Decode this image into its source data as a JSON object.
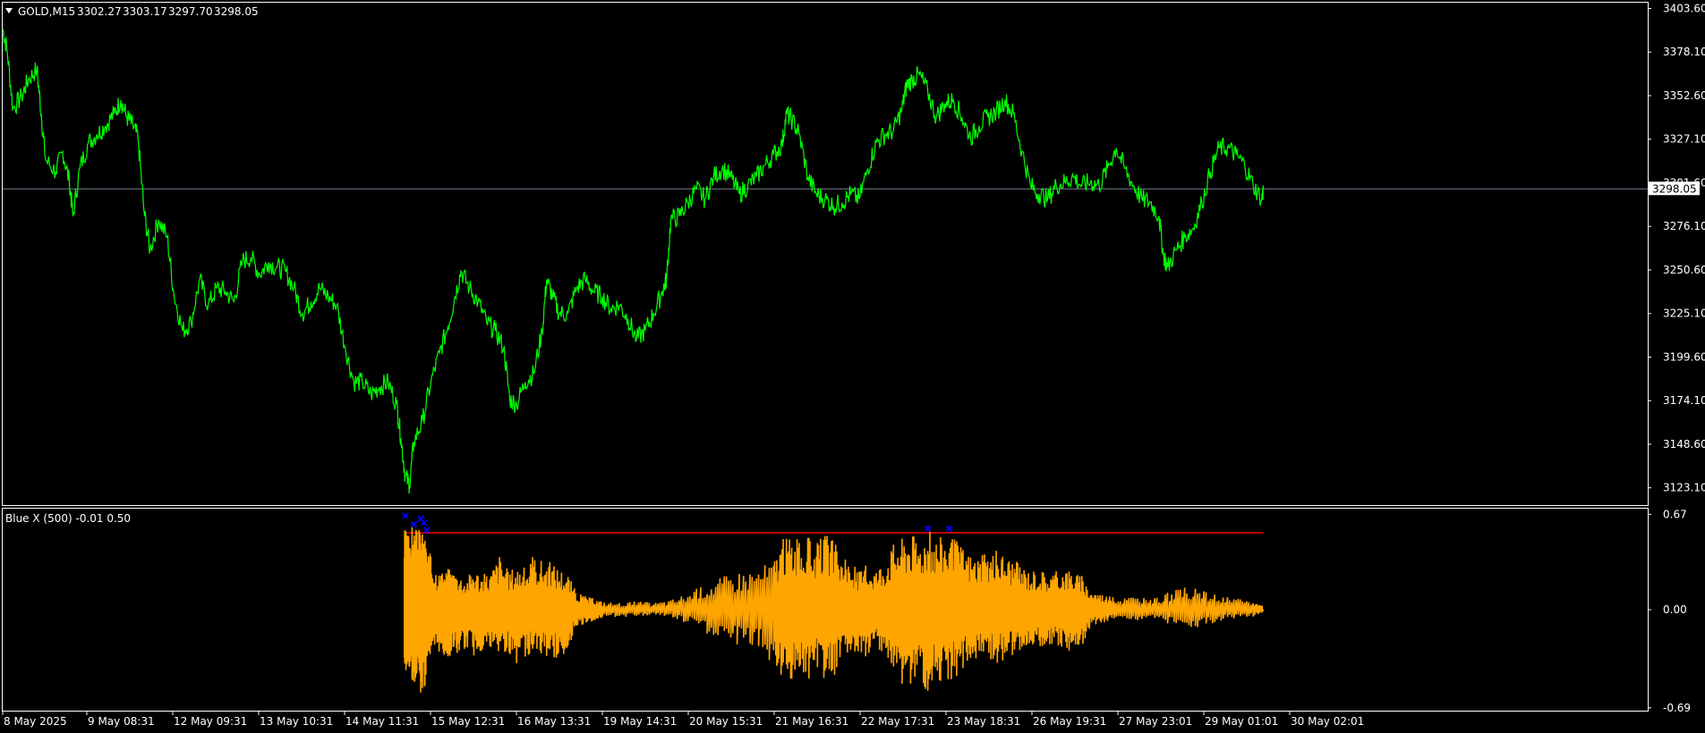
{
  "main_header": {
    "dropdown_icon": "triangle-down-icon",
    "symbol": "GOLD,M15",
    "open": "3302.27",
    "high": "3303.17",
    "low": "3297.70",
    "close": "3298.05"
  },
  "indicator_header": {
    "label": "Blue X (500) -0.01 0.50"
  },
  "colors": {
    "background": "#000000",
    "price_line": "#00ff00",
    "indicator": "#ffa500",
    "threshold": "#ff0000",
    "signal": "#0000ff",
    "frame": "#ffffff",
    "bid_line": "#708090"
  },
  "chart_data": [
    {
      "type": "line",
      "name_in_chart": "GOLD,M15",
      "y_ticks": [
        "3403.60",
        "3378.10",
        "3352.60",
        "3327.10",
        "3301.60",
        "3276.10",
        "3250.60",
        "3225.10",
        "3199.60",
        "3174.10",
        "3148.60",
        "3123.10"
      ],
      "ylim": [
        3113.0,
        3407.0
      ],
      "current_price_label": "3298.05",
      "current_price": 3298.05,
      "x_ticks": [
        "8 May 2025",
        "9 May 08:31",
        "12 May 09:31",
        "13 May 10:31",
        "14 May 11:31",
        "15 May 12:31",
        "16 May 13:31",
        "19 May 14:31",
        "20 May 15:31",
        "21 May 16:31",
        "22 May 17:31",
        "23 May 18:31",
        "26 May 19:31",
        "27 May 23:01",
        "29 May 01:01",
        "30 May 02:01"
      ],
      "x_range": [
        0,
        15.35
      ],
      "points": [
        [
          0,
          3392
        ],
        [
          0.05,
          3380
        ],
        [
          0.12,
          3345
        ],
        [
          0.22,
          3352
        ],
        [
          0.3,
          3362
        ],
        [
          0.4,
          3368
        ],
        [
          0.45,
          3342
        ],
        [
          0.5,
          3315
        ],
        [
          0.62,
          3308
        ],
        [
          0.7,
          3320
        ],
        [
          0.78,
          3302
        ],
        [
          0.82,
          3282
        ],
        [
          0.9,
          3310
        ],
        [
          1.0,
          3325
        ],
        [
          1.1,
          3330
        ],
        [
          1.2,
          3335
        ],
        [
          1.3,
          3342
        ],
        [
          1.38,
          3350
        ],
        [
          1.45,
          3340
        ],
        [
          1.52,
          3335
        ],
        [
          1.58,
          3328
        ],
        [
          1.65,
          3285
        ],
        [
          1.72,
          3262
        ],
        [
          1.82,
          3280
        ],
        [
          1.92,
          3270
        ],
        [
          2.0,
          3236
        ],
        [
          2.1,
          3215
        ],
        [
          2.2,
          3220
        ],
        [
          2.3,
          3245
        ],
        [
          2.4,
          3230
        ],
        [
          2.5,
          3240
        ],
        [
          2.6,
          3238
        ],
        [
          2.7,
          3232
        ],
        [
          2.8,
          3256
        ],
        [
          2.9,
          3258
        ],
        [
          3.0,
          3248
        ],
        [
          3.1,
          3255
        ],
        [
          3.2,
          3252
        ],
        [
          3.3,
          3250
        ],
        [
          3.4,
          3240
        ],
        [
          3.5,
          3225
        ],
        [
          3.6,
          3232
        ],
        [
          3.7,
          3240
        ],
        [
          3.8,
          3235
        ],
        [
          3.9,
          3230
        ],
        [
          4.0,
          3205
        ],
        [
          4.1,
          3185
        ],
        [
          4.2,
          3185
        ],
        [
          4.3,
          3178
        ],
        [
          4.4,
          3182
        ],
        [
          4.5,
          3185
        ],
        [
          4.6,
          3172
        ],
        [
          4.65,
          3152
        ],
        [
          4.7,
          3130
        ],
        [
          4.75,
          3125
        ],
        [
          4.8,
          3150
        ],
        [
          4.9,
          3162
        ],
        [
          5.0,
          3185
        ],
        [
          5.1,
          3202
        ],
        [
          5.2,
          3218
        ],
        [
          5.28,
          3235
        ],
        [
          5.35,
          3250
        ],
        [
          5.45,
          3240
        ],
        [
          5.55,
          3232
        ],
        [
          5.65,
          3220
        ],
        [
          5.75,
          3215
        ],
        [
          5.85,
          3205
        ],
        [
          5.92,
          3175
        ],
        [
          6.0,
          3172
        ],
        [
          6.1,
          3185
        ],
        [
          6.2,
          3190
        ],
        [
          6.3,
          3215
        ],
        [
          6.35,
          3245
        ],
        [
          6.42,
          3235
        ],
        [
          6.5,
          3225
        ],
        [
          6.6,
          3225
        ],
        [
          6.7,
          3240
        ],
        [
          6.8,
          3245
        ],
        [
          6.9,
          3238
        ],
        [
          7.0,
          3235
        ],
        [
          7.1,
          3228
        ],
        [
          7.2,
          3230
        ],
        [
          7.3,
          3222
        ],
        [
          7.4,
          3210
        ],
        [
          7.5,
          3215
        ],
        [
          7.6,
          3225
        ],
        [
          7.7,
          3238
        ],
        [
          7.75,
          3245
        ],
        [
          7.8,
          3280
        ],
        [
          7.9,
          3282
        ],
        [
          8.0,
          3290
        ],
        [
          8.1,
          3298
        ],
        [
          8.2,
          3292
        ],
        [
          8.3,
          3305
        ],
        [
          8.4,
          3310
        ],
        [
          8.5,
          3305
        ],
        [
          8.6,
          3295
        ],
        [
          8.7,
          3300
        ],
        [
          8.8,
          3305
        ],
        [
          8.9,
          3312
        ],
        [
          9.0,
          3318
        ],
        [
          9.1,
          3324
        ],
        [
          9.15,
          3342
        ],
        [
          9.22,
          3338
        ],
        [
          9.3,
          3330
        ],
        [
          9.4,
          3305
        ],
        [
          9.5,
          3295
        ],
        [
          9.6,
          3292
        ],
        [
          9.7,
          3288
        ],
        [
          9.8,
          3290
        ],
        [
          9.9,
          3295
        ],
        [
          10.0,
          3292
        ],
        [
          10.1,
          3310
        ],
        [
          10.2,
          3325
        ],
        [
          10.3,
          3330
        ],
        [
          10.4,
          3332
        ],
        [
          10.5,
          3345
        ],
        [
          10.55,
          3358
        ],
        [
          10.62,
          3362
        ],
        [
          10.7,
          3365
        ],
        [
          10.8,
          3355
        ],
        [
          10.9,
          3340
        ],
        [
          11.0,
          3348
        ],
        [
          11.1,
          3350
        ],
        [
          11.2,
          3340
        ],
        [
          11.3,
          3328
        ],
        [
          11.4,
          3335
        ],
        [
          11.5,
          3340
        ],
        [
          11.6,
          3343
        ],
        [
          11.7,
          3350
        ],
        [
          11.8,
          3342
        ],
        [
          11.9,
          3320
        ],
        [
          12.0,
          3300
        ],
        [
          12.1,
          3295
        ],
        [
          12.2,
          3292
        ],
        [
          12.3,
          3300
        ],
        [
          12.4,
          3302
        ],
        [
          12.5,
          3305
        ],
        [
          12.6,
          3300
        ],
        [
          12.7,
          3302
        ],
        [
          12.8,
          3300
        ],
        [
          12.9,
          3310
        ],
        [
          13.0,
          3322
        ],
        [
          13.1,
          3310
        ],
        [
          13.2,
          3300
        ],
        [
          13.3,
          3292
        ],
        [
          13.4,
          3290
        ],
        [
          13.5,
          3282
        ],
        [
          13.55,
          3260
        ],
        [
          13.6,
          3252
        ],
        [
          13.7,
          3262
        ],
        [
          13.8,
          3270
        ],
        [
          13.9,
          3275
        ],
        [
          14.0,
          3290
        ],
        [
          14.1,
          3308
        ],
        [
          14.2,
          3322
        ],
        [
          14.3,
          3322
        ],
        [
          14.4,
          3318
        ],
        [
          14.5,
          3312
        ],
        [
          14.6,
          3300
        ],
        [
          14.7,
          3292
        ],
        [
          14.72,
          3298
        ]
      ]
    },
    {
      "type": "bar",
      "name_in_chart": "Blue X (500)",
      "y_ticks": [
        "0.67",
        "0.00",
        "-0.69"
      ],
      "ylim": [
        -0.71,
        0.71
      ],
      "threshold": 0.54,
      "x_range": [
        0,
        15.35
      ],
      "segments": [
        [
          4.69,
          0.58,
          -0.59
        ],
        [
          4.72,
          0.55,
          -0.45
        ],
        [
          4.76,
          0.6,
          -0.48
        ],
        [
          4.8,
          0.6,
          -0.55
        ],
        [
          4.84,
          0.56,
          -0.44
        ],
        [
          4.88,
          0.58,
          -0.6
        ],
        [
          4.92,
          0.54,
          -0.62
        ],
        [
          4.96,
          0.45,
          -0.34
        ],
        [
          5.02,
          0.35,
          -0.4
        ],
        [
          5.08,
          0.28,
          -0.3
        ],
        [
          5.14,
          0.25,
          -0.36
        ],
        [
          5.2,
          0.3,
          -0.34
        ],
        [
          5.26,
          0.28,
          -0.3
        ],
        [
          5.32,
          0.26,
          -0.32
        ],
        [
          5.4,
          0.22,
          -0.28
        ],
        [
          5.5,
          0.3,
          -0.35
        ],
        [
          5.6,
          0.25,
          -0.3
        ],
        [
          5.7,
          0.28,
          -0.32
        ],
        [
          5.8,
          0.4,
          -0.35
        ],
        [
          5.9,
          0.28,
          -0.3
        ],
        [
          6.0,
          0.32,
          -0.38
        ],
        [
          6.1,
          0.3,
          -0.35
        ],
        [
          6.2,
          0.38,
          -0.3
        ],
        [
          6.3,
          0.36,
          -0.32
        ],
        [
          6.4,
          0.34,
          -0.38
        ],
        [
          6.5,
          0.3,
          -0.36
        ],
        [
          6.6,
          0.26,
          -0.28
        ],
        [
          6.7,
          0.12,
          -0.12
        ],
        [
          6.8,
          0.1,
          -0.1
        ],
        [
          6.9,
          0.08,
          -0.08
        ],
        [
          7.0,
          0.06,
          -0.06
        ],
        [
          7.2,
          0.05,
          -0.05
        ],
        [
          7.4,
          0.06,
          -0.05
        ],
        [
          7.6,
          0.05,
          -0.04
        ],
        [
          7.8,
          0.07,
          -0.06
        ],
        [
          8.0,
          0.12,
          -0.1
        ],
        [
          8.2,
          0.18,
          -0.16
        ],
        [
          8.4,
          0.24,
          -0.22
        ],
        [
          8.6,
          0.28,
          -0.25
        ],
        [
          8.8,
          0.3,
          -0.26
        ],
        [
          9.0,
          0.36,
          -0.4
        ],
        [
          9.1,
          0.5,
          -0.48
        ],
        [
          9.2,
          0.54,
          -0.52
        ],
        [
          9.3,
          0.48,
          -0.46
        ],
        [
          9.4,
          0.52,
          -0.5
        ],
        [
          9.5,
          0.46,
          -0.44
        ],
        [
          9.6,
          0.54,
          -0.52
        ],
        [
          9.7,
          0.5,
          -0.48
        ],
        [
          9.8,
          0.36,
          -0.32
        ],
        [
          9.9,
          0.34,
          -0.3
        ],
        [
          10.0,
          0.28,
          -0.3
        ],
        [
          10.1,
          0.32,
          -0.34
        ],
        [
          10.2,
          0.3,
          -0.28
        ],
        [
          10.3,
          0.36,
          -0.32
        ],
        [
          10.4,
          0.48,
          -0.52
        ],
        [
          10.5,
          0.52,
          -0.56
        ],
        [
          10.6,
          0.56,
          -0.58
        ],
        [
          10.7,
          0.5,
          -0.54
        ],
        [
          10.8,
          0.56,
          -0.58
        ],
        [
          10.9,
          0.52,
          -0.5
        ],
        [
          11.0,
          0.54,
          -0.52
        ],
        [
          11.1,
          0.5,
          -0.48
        ],
        [
          11.2,
          0.46,
          -0.44
        ],
        [
          11.3,
          0.4,
          -0.38
        ],
        [
          11.4,
          0.38,
          -0.34
        ],
        [
          11.5,
          0.4,
          -0.36
        ],
        [
          11.6,
          0.42,
          -0.38
        ],
        [
          11.7,
          0.4,
          -0.36
        ],
        [
          11.8,
          0.36,
          -0.32
        ],
        [
          11.9,
          0.32,
          -0.28
        ],
        [
          12.0,
          0.28,
          -0.26
        ],
        [
          12.1,
          0.3,
          -0.28
        ],
        [
          12.2,
          0.26,
          -0.24
        ],
        [
          12.3,
          0.28,
          -0.26
        ],
        [
          12.4,
          0.3,
          -0.3
        ],
        [
          12.5,
          0.28,
          -0.28
        ],
        [
          12.6,
          0.24,
          -0.26
        ],
        [
          12.7,
          0.14,
          -0.12
        ],
        [
          12.8,
          0.12,
          -0.1
        ],
        [
          12.9,
          0.1,
          -0.08
        ],
        [
          13.0,
          0.08,
          -0.06
        ],
        [
          13.2,
          0.1,
          -0.08
        ],
        [
          13.4,
          0.07,
          -0.06
        ],
        [
          13.6,
          0.12,
          -0.1
        ],
        [
          13.8,
          0.16,
          -0.14
        ],
        [
          14.0,
          0.14,
          -0.12
        ],
        [
          14.2,
          0.1,
          -0.08
        ],
        [
          14.4,
          0.08,
          -0.06
        ],
        [
          14.6,
          0.06,
          -0.05
        ],
        [
          14.72,
          0.03,
          -0.02
        ]
      ],
      "signals": [
        [
          4.7,
          0.66
        ],
        [
          4.8,
          0.6
        ],
        [
          4.88,
          0.64
        ],
        [
          4.92,
          0.61
        ],
        [
          4.95,
          0.56
        ],
        [
          10.8,
          0.57
        ],
        [
          11.05,
          0.57
        ]
      ]
    }
  ]
}
